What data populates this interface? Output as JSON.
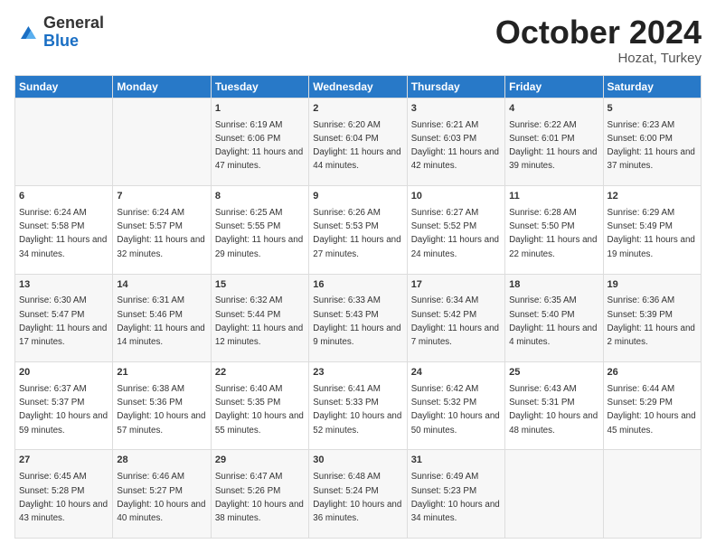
{
  "header": {
    "logo_general": "General",
    "logo_blue": "Blue",
    "month_title": "October 2024",
    "location": "Hozat, Turkey"
  },
  "weekdays": [
    "Sunday",
    "Monday",
    "Tuesday",
    "Wednesday",
    "Thursday",
    "Friday",
    "Saturday"
  ],
  "weeks": [
    [
      {
        "day": "",
        "sunrise": "",
        "sunset": "",
        "daylight": ""
      },
      {
        "day": "",
        "sunrise": "",
        "sunset": "",
        "daylight": ""
      },
      {
        "day": "1",
        "sunrise": "Sunrise: 6:19 AM",
        "sunset": "Sunset: 6:06 PM",
        "daylight": "Daylight: 11 hours and 47 minutes."
      },
      {
        "day": "2",
        "sunrise": "Sunrise: 6:20 AM",
        "sunset": "Sunset: 6:04 PM",
        "daylight": "Daylight: 11 hours and 44 minutes."
      },
      {
        "day": "3",
        "sunrise": "Sunrise: 6:21 AM",
        "sunset": "Sunset: 6:03 PM",
        "daylight": "Daylight: 11 hours and 42 minutes."
      },
      {
        "day": "4",
        "sunrise": "Sunrise: 6:22 AM",
        "sunset": "Sunset: 6:01 PM",
        "daylight": "Daylight: 11 hours and 39 minutes."
      },
      {
        "day": "5",
        "sunrise": "Sunrise: 6:23 AM",
        "sunset": "Sunset: 6:00 PM",
        "daylight": "Daylight: 11 hours and 37 minutes."
      }
    ],
    [
      {
        "day": "6",
        "sunrise": "Sunrise: 6:24 AM",
        "sunset": "Sunset: 5:58 PM",
        "daylight": "Daylight: 11 hours and 34 minutes."
      },
      {
        "day": "7",
        "sunrise": "Sunrise: 6:24 AM",
        "sunset": "Sunset: 5:57 PM",
        "daylight": "Daylight: 11 hours and 32 minutes."
      },
      {
        "day": "8",
        "sunrise": "Sunrise: 6:25 AM",
        "sunset": "Sunset: 5:55 PM",
        "daylight": "Daylight: 11 hours and 29 minutes."
      },
      {
        "day": "9",
        "sunrise": "Sunrise: 6:26 AM",
        "sunset": "Sunset: 5:53 PM",
        "daylight": "Daylight: 11 hours and 27 minutes."
      },
      {
        "day": "10",
        "sunrise": "Sunrise: 6:27 AM",
        "sunset": "Sunset: 5:52 PM",
        "daylight": "Daylight: 11 hours and 24 minutes."
      },
      {
        "day": "11",
        "sunrise": "Sunrise: 6:28 AM",
        "sunset": "Sunset: 5:50 PM",
        "daylight": "Daylight: 11 hours and 22 minutes."
      },
      {
        "day": "12",
        "sunrise": "Sunrise: 6:29 AM",
        "sunset": "Sunset: 5:49 PM",
        "daylight": "Daylight: 11 hours and 19 minutes."
      }
    ],
    [
      {
        "day": "13",
        "sunrise": "Sunrise: 6:30 AM",
        "sunset": "Sunset: 5:47 PM",
        "daylight": "Daylight: 11 hours and 17 minutes."
      },
      {
        "day": "14",
        "sunrise": "Sunrise: 6:31 AM",
        "sunset": "Sunset: 5:46 PM",
        "daylight": "Daylight: 11 hours and 14 minutes."
      },
      {
        "day": "15",
        "sunrise": "Sunrise: 6:32 AM",
        "sunset": "Sunset: 5:44 PM",
        "daylight": "Daylight: 11 hours and 12 minutes."
      },
      {
        "day": "16",
        "sunrise": "Sunrise: 6:33 AM",
        "sunset": "Sunset: 5:43 PM",
        "daylight": "Daylight: 11 hours and 9 minutes."
      },
      {
        "day": "17",
        "sunrise": "Sunrise: 6:34 AM",
        "sunset": "Sunset: 5:42 PM",
        "daylight": "Daylight: 11 hours and 7 minutes."
      },
      {
        "day": "18",
        "sunrise": "Sunrise: 6:35 AM",
        "sunset": "Sunset: 5:40 PM",
        "daylight": "Daylight: 11 hours and 4 minutes."
      },
      {
        "day": "19",
        "sunrise": "Sunrise: 6:36 AM",
        "sunset": "Sunset: 5:39 PM",
        "daylight": "Daylight: 11 hours and 2 minutes."
      }
    ],
    [
      {
        "day": "20",
        "sunrise": "Sunrise: 6:37 AM",
        "sunset": "Sunset: 5:37 PM",
        "daylight": "Daylight: 10 hours and 59 minutes."
      },
      {
        "day": "21",
        "sunrise": "Sunrise: 6:38 AM",
        "sunset": "Sunset: 5:36 PM",
        "daylight": "Daylight: 10 hours and 57 minutes."
      },
      {
        "day": "22",
        "sunrise": "Sunrise: 6:40 AM",
        "sunset": "Sunset: 5:35 PM",
        "daylight": "Daylight: 10 hours and 55 minutes."
      },
      {
        "day": "23",
        "sunrise": "Sunrise: 6:41 AM",
        "sunset": "Sunset: 5:33 PM",
        "daylight": "Daylight: 10 hours and 52 minutes."
      },
      {
        "day": "24",
        "sunrise": "Sunrise: 6:42 AM",
        "sunset": "Sunset: 5:32 PM",
        "daylight": "Daylight: 10 hours and 50 minutes."
      },
      {
        "day": "25",
        "sunrise": "Sunrise: 6:43 AM",
        "sunset": "Sunset: 5:31 PM",
        "daylight": "Daylight: 10 hours and 48 minutes."
      },
      {
        "day": "26",
        "sunrise": "Sunrise: 6:44 AM",
        "sunset": "Sunset: 5:29 PM",
        "daylight": "Daylight: 10 hours and 45 minutes."
      }
    ],
    [
      {
        "day": "27",
        "sunrise": "Sunrise: 6:45 AM",
        "sunset": "Sunset: 5:28 PM",
        "daylight": "Daylight: 10 hours and 43 minutes."
      },
      {
        "day": "28",
        "sunrise": "Sunrise: 6:46 AM",
        "sunset": "Sunset: 5:27 PM",
        "daylight": "Daylight: 10 hours and 40 minutes."
      },
      {
        "day": "29",
        "sunrise": "Sunrise: 6:47 AM",
        "sunset": "Sunset: 5:26 PM",
        "daylight": "Daylight: 10 hours and 38 minutes."
      },
      {
        "day": "30",
        "sunrise": "Sunrise: 6:48 AM",
        "sunset": "Sunset: 5:24 PM",
        "daylight": "Daylight: 10 hours and 36 minutes."
      },
      {
        "day": "31",
        "sunrise": "Sunrise: 6:49 AM",
        "sunset": "Sunset: 5:23 PM",
        "daylight": "Daylight: 10 hours and 34 minutes."
      },
      {
        "day": "",
        "sunrise": "",
        "sunset": "",
        "daylight": ""
      },
      {
        "day": "",
        "sunrise": "",
        "sunset": "",
        "daylight": ""
      }
    ]
  ]
}
